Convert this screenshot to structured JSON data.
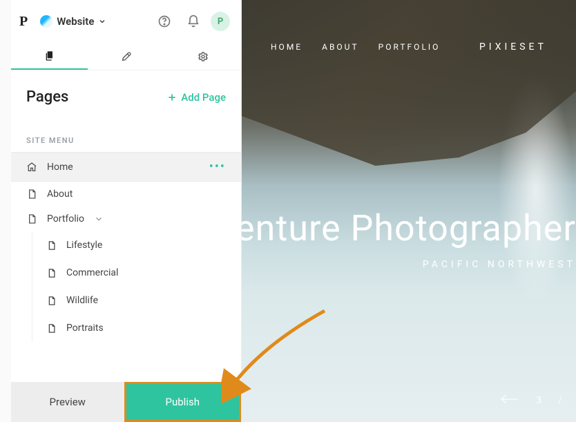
{
  "topbar": {
    "logo_letter": "P",
    "site_name": "Website",
    "avatar_initial": "P"
  },
  "sidebar": {
    "pages_title": "Pages",
    "add_page_label": "Add Page",
    "menu_label": "SITE MENU",
    "items": [
      {
        "label": "Home",
        "icon": "home",
        "selected": true
      },
      {
        "label": "About",
        "icon": "page"
      },
      {
        "label": "Portfolio",
        "icon": "page",
        "has_children": true,
        "children": [
          {
            "label": "Lifestyle"
          },
          {
            "label": "Commercial"
          },
          {
            "label": "Wildlife"
          },
          {
            "label": "Portraits"
          }
        ]
      }
    ]
  },
  "actions": {
    "preview": "Preview",
    "publish": "Publish"
  },
  "preview": {
    "nav": [
      "HOME",
      "ABOUT",
      "PORTFOLIO"
    ],
    "brand": "PIXIESET",
    "hero_title": "Adventure Photographer",
    "hero_subtitle": "PACIFIC NORTHWEST",
    "pager": {
      "current": "3",
      "sep": "/"
    }
  }
}
